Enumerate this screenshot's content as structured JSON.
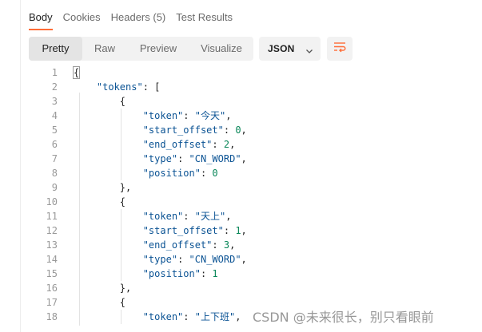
{
  "tabs": [
    {
      "label": "Body",
      "active": true
    },
    {
      "label": "Cookies",
      "active": false
    },
    {
      "label": "Headers (5)",
      "active": false
    },
    {
      "label": "Test Results",
      "active": false
    }
  ],
  "view_modes": [
    {
      "label": "Pretty",
      "active": true
    },
    {
      "label": "Raw",
      "active": false
    },
    {
      "label": "Preview",
      "active": false
    },
    {
      "label": "Visualize",
      "active": false
    }
  ],
  "format": {
    "selected": "JSON"
  },
  "accent_color": "#ff6c37",
  "icons": {
    "format_dropdown": "chevron-down-icon",
    "wrap": "wrap-lines-icon"
  },
  "code_lines": [
    {
      "n": "1",
      "tokens": [
        {
          "t": "{",
          "c": "punc hl"
        }
      ]
    },
    {
      "n": "2",
      "tokens": [
        {
          "t": "    ",
          "c": ""
        },
        {
          "t": "\"tokens\"",
          "c": "str"
        },
        {
          "t": ": [",
          "c": "punc"
        }
      ]
    },
    {
      "n": "3",
      "tokens": [
        {
          "t": "        {",
          "c": "punc"
        }
      ]
    },
    {
      "n": "4",
      "tokens": [
        {
          "t": "            ",
          "c": ""
        },
        {
          "t": "\"token\"",
          "c": "str"
        },
        {
          "t": ": ",
          "c": "punc"
        },
        {
          "t": "\"今天\"",
          "c": "str"
        },
        {
          "t": ",",
          "c": "punc"
        }
      ]
    },
    {
      "n": "5",
      "tokens": [
        {
          "t": "            ",
          "c": ""
        },
        {
          "t": "\"start_offset\"",
          "c": "str"
        },
        {
          "t": ": ",
          "c": "punc"
        },
        {
          "t": "0",
          "c": "num"
        },
        {
          "t": ",",
          "c": "punc"
        }
      ]
    },
    {
      "n": "6",
      "tokens": [
        {
          "t": "            ",
          "c": ""
        },
        {
          "t": "\"end_offset\"",
          "c": "str"
        },
        {
          "t": ": ",
          "c": "punc"
        },
        {
          "t": "2",
          "c": "num"
        },
        {
          "t": ",",
          "c": "punc"
        }
      ]
    },
    {
      "n": "7",
      "tokens": [
        {
          "t": "            ",
          "c": ""
        },
        {
          "t": "\"type\"",
          "c": "str"
        },
        {
          "t": ": ",
          "c": "punc"
        },
        {
          "t": "\"CN_WORD\"",
          "c": "str"
        },
        {
          "t": ",",
          "c": "punc"
        }
      ]
    },
    {
      "n": "8",
      "tokens": [
        {
          "t": "            ",
          "c": ""
        },
        {
          "t": "\"position\"",
          "c": "str"
        },
        {
          "t": ": ",
          "c": "punc"
        },
        {
          "t": "0",
          "c": "num"
        }
      ]
    },
    {
      "n": "9",
      "tokens": [
        {
          "t": "        },",
          "c": "punc"
        }
      ]
    },
    {
      "n": "10",
      "tokens": [
        {
          "t": "        {",
          "c": "punc"
        }
      ]
    },
    {
      "n": "11",
      "tokens": [
        {
          "t": "            ",
          "c": ""
        },
        {
          "t": "\"token\"",
          "c": "str"
        },
        {
          "t": ": ",
          "c": "punc"
        },
        {
          "t": "\"天上\"",
          "c": "str"
        },
        {
          "t": ",",
          "c": "punc"
        }
      ]
    },
    {
      "n": "12",
      "tokens": [
        {
          "t": "            ",
          "c": ""
        },
        {
          "t": "\"start_offset\"",
          "c": "str"
        },
        {
          "t": ": ",
          "c": "punc"
        },
        {
          "t": "1",
          "c": "num"
        },
        {
          "t": ",",
          "c": "punc"
        }
      ]
    },
    {
      "n": "13",
      "tokens": [
        {
          "t": "            ",
          "c": ""
        },
        {
          "t": "\"end_offset\"",
          "c": "str"
        },
        {
          "t": ": ",
          "c": "punc"
        },
        {
          "t": "3",
          "c": "num"
        },
        {
          "t": ",",
          "c": "punc"
        }
      ]
    },
    {
      "n": "14",
      "tokens": [
        {
          "t": "            ",
          "c": ""
        },
        {
          "t": "\"type\"",
          "c": "str"
        },
        {
          "t": ": ",
          "c": "punc"
        },
        {
          "t": "\"CN_WORD\"",
          "c": "str"
        },
        {
          "t": ",",
          "c": "punc"
        }
      ]
    },
    {
      "n": "15",
      "tokens": [
        {
          "t": "            ",
          "c": ""
        },
        {
          "t": "\"position\"",
          "c": "str"
        },
        {
          "t": ": ",
          "c": "punc"
        },
        {
          "t": "1",
          "c": "num"
        }
      ]
    },
    {
      "n": "16",
      "tokens": [
        {
          "t": "        },",
          "c": "punc"
        }
      ]
    },
    {
      "n": "17",
      "tokens": [
        {
          "t": "        {",
          "c": "punc"
        }
      ]
    },
    {
      "n": "18",
      "tokens": [
        {
          "t": "            ",
          "c": ""
        },
        {
          "t": "\"token\"",
          "c": "str"
        },
        {
          "t": ": ",
          "c": "punc"
        },
        {
          "t": "\"上下班\"",
          "c": "str"
        },
        {
          "t": ",",
          "c": "punc"
        }
      ]
    }
  ],
  "watermark": "CSDN @未来很长，别只看眼前"
}
